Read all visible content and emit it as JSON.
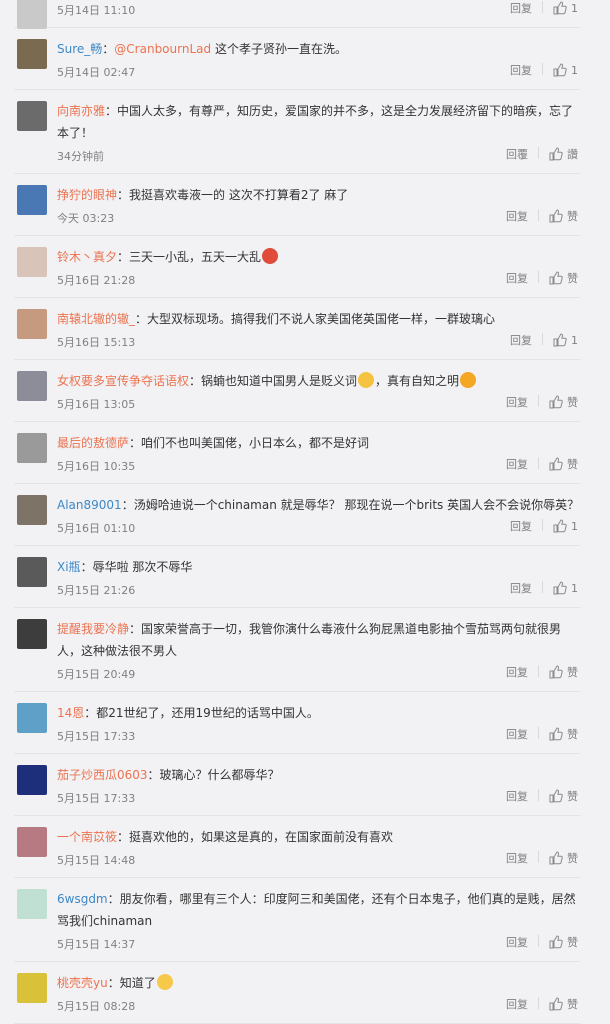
{
  "comments": [
    {
      "avatar_color": "#c9c9c9",
      "user": "",
      "user_color": "#eb7350",
      "text": "",
      "time": "5月14日 11:10",
      "reply": "回复",
      "like": "1"
    },
    {
      "avatar_color": "#7a6a4f",
      "user": "Sure_畅",
      "user_color": "#3c88c6",
      "mention": "@CranbournLad",
      "text": " 这个孝子贤孙一直在洗。",
      "time": "5月14日 02:47",
      "reply": "回复",
      "like": "1"
    },
    {
      "avatar_color": "#6b6b6b",
      "user": "向南亦雅",
      "user_color": "#eb7350",
      "text": "：中国人太多，有尊严，知历史，爱国家的并不多，这是全力发展经济留下的暗疾，忘了本了！",
      "time": "34分钟前",
      "reply": "回覆",
      "like": "讚"
    },
    {
      "avatar_color": "#4a78b4",
      "user": "挣狞的眼神",
      "user_color": "#eb7350",
      "text": "：我挺喜欢毒液一的  这次不打算看2了  麻了",
      "time": "今天 03:23",
      "reply": "回复",
      "like": "赞"
    },
    {
      "avatar_color": "#d8c4b8",
      "user": "铃木丶真夕",
      "user_color": "#eb7350",
      "text": "：三天一小乱，五天一大乱",
      "emoji_after": "#e04b3a",
      "time": "5月16日 21:28",
      "reply": "回复",
      "like": "赞"
    },
    {
      "avatar_color": "#c59a7e",
      "user": "南辕北辙的辙_",
      "user_color": "#eb7350",
      "text": "：大型双标现场。搞得我们不说人家美国佬英国佬一样，一群玻璃心",
      "time": "5月16日 15:13",
      "reply": "回复",
      "like": "1"
    },
    {
      "avatar_color": "#8d8d9a",
      "user": "女权要多宣传争夺话语权",
      "user_color": "#eb7350",
      "text": "：锅蝻也知道中国男人是贬义词",
      "emoji_mid": "#f5c242",
      "text2": "，真有自知之明",
      "emoji_after": "#f5a623",
      "time": "5月16日 13:05",
      "reply": "回复",
      "like": "赞"
    },
    {
      "avatar_color": "#9a9a9a",
      "user": "最后的敖德萨",
      "user_color": "#eb7350",
      "text": "：咱们不也叫美国佬，小日本么，都不是好词",
      "time": "5月16日 10:35",
      "reply": "回复",
      "like": "赞"
    },
    {
      "avatar_color": "#7d7467",
      "user": "Alan89001",
      "user_color": "#3c88c6",
      "text": "：汤姆哈迪说一个chinaman 就是辱华？ 那现在说一个brits 英国人会不会说你辱英？",
      "time": "5月16日 01:10",
      "reply": "回复",
      "like": "1"
    },
    {
      "avatar_color": "#5a5a5a",
      "user": "Xi瓶",
      "user_color": "#3c88c6",
      "text": "：辱华啦 那次不辱华",
      "time": "5月15日 21:26",
      "reply": "回复",
      "like": "1"
    },
    {
      "avatar_color": "#3d3d3d",
      "user": "提醒我要冷静",
      "user_color": "#eb7350",
      "text": "：国家荣誉高于一切，我管你演什么毒液什么狗屁黑道电影抽个雪茄骂两句就很男人，这种做法很不男人",
      "time": "5月15日 20:49",
      "reply": "回复",
      "like": "赞"
    },
    {
      "avatar_color": "#5fa0c8",
      "user": "14恩",
      "user_color": "#eb7350",
      "text": "：都21世纪了，还用19世纪的话骂中国人。",
      "time": "5月15日 17:33",
      "reply": "回复",
      "like": "赞"
    },
    {
      "avatar_color": "#1d2f7a",
      "user": "茄子炒西瓜0603",
      "user_color": "#eb7350",
      "text": "：玻璃心？什么都辱华？",
      "time": "5月15日 17:33",
      "reply": "回复",
      "like": "赞"
    },
    {
      "avatar_color": "#b77a82",
      "user": "一个南苡筱",
      "user_color": "#eb7350",
      "text": "：挺喜欢他的，如果这是真的，在国家面前没有喜欢",
      "time": "5月15日 14:48",
      "reply": "回复",
      "like": "赞"
    },
    {
      "avatar_color": "#bfe0d2",
      "user": "6wsgdm",
      "user_color": "#3c88c6",
      "text": "：朋友你看，哪里有三个人：印度阿三和美国佬，还有个日本鬼子，他们真的是贱，居然骂我们chinaman",
      "time": "5月15日 14:37",
      "reply": "回复",
      "like": "赞"
    },
    {
      "avatar_color": "#d9c23a",
      "user": "桃壳壳yu",
      "user_color": "#eb7350",
      "text": "：知道了",
      "emoji_after": "#f6c94a",
      "time": "5月15日 08:28",
      "reply": "回复",
      "like": "赞"
    }
  ]
}
